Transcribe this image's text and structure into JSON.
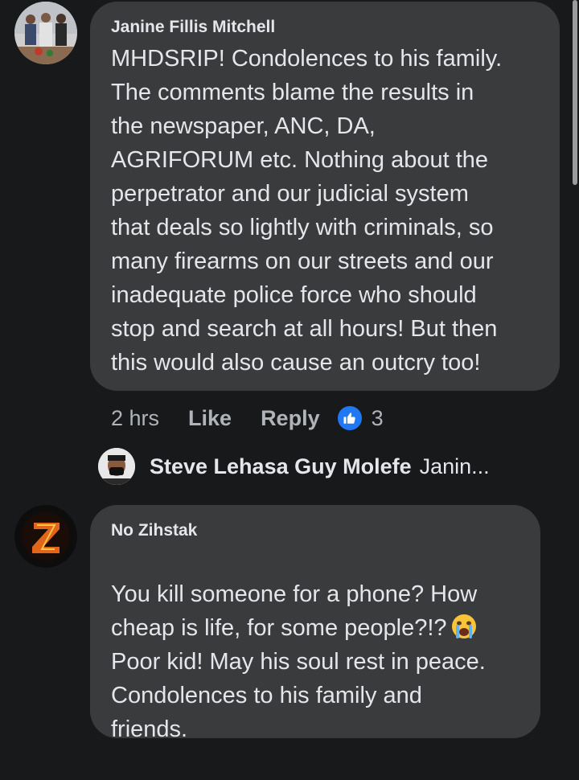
{
  "comments": [
    {
      "author": "Janine Fillis Mitchell",
      "text": "MHDSRIP! Condolences to his family.\nThe comments blame the results in\nthe newspaper,  ANC, DA,\nAGRIFORUM etc. Nothing about the\nperpetrator and our judicial system\nthat deals so lightly with criminals, so\nmany firearms on our streets and our\ninadequate police force who should\nstop and search at all hours! But then\nthis would also cause an outcry too!",
      "time": "2 hrs",
      "like_label": "Like",
      "reply_label": "Reply",
      "reaction_count": "3",
      "reaction_icon": "thumbs-up-icon",
      "reply_preview": {
        "author": "Steve Lehasa Guy Molefe",
        "snippet": "Janin..."
      }
    },
    {
      "author": "No Zihstak",
      "text_before_emoji": "You kill someone for a phone? How\ncheap is life, for some people?!?",
      "emoji": "crying-face-icon",
      "text_after_emoji": "Poor kid! May his soul rest in peace.\nCondolences to his family and\nfriends."
    }
  ],
  "colors": {
    "background": "#18191a",
    "bubble": "#3a3b3c",
    "text": "#e4e6eb",
    "secondary_text": "#b0b3b8",
    "like_blue": "#2078f4"
  }
}
